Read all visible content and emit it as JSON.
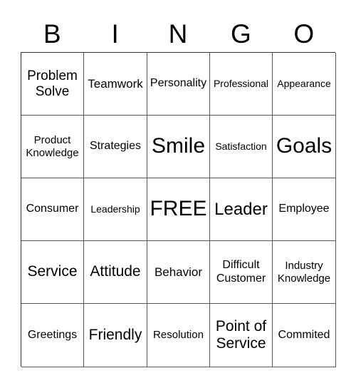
{
  "header": [
    "B",
    "I",
    "N",
    "G",
    "O"
  ],
  "rows": [
    [
      "Problem Solve",
      "Teamwork",
      "Personality",
      "Professional",
      "Appearance"
    ],
    [
      "Product Knowledge",
      "Strategies",
      "Smile",
      "Satisfaction",
      "Goals"
    ],
    [
      "Consumer",
      "Leadership",
      "FREE",
      "Leader",
      "Employee"
    ],
    [
      "Service",
      "Attitude",
      "Behavior",
      "Difficult Customer",
      "Industry Knowledge"
    ],
    [
      "Greetings",
      "Friendly",
      "Resolution",
      "Point of Service",
      "Commited"
    ]
  ]
}
